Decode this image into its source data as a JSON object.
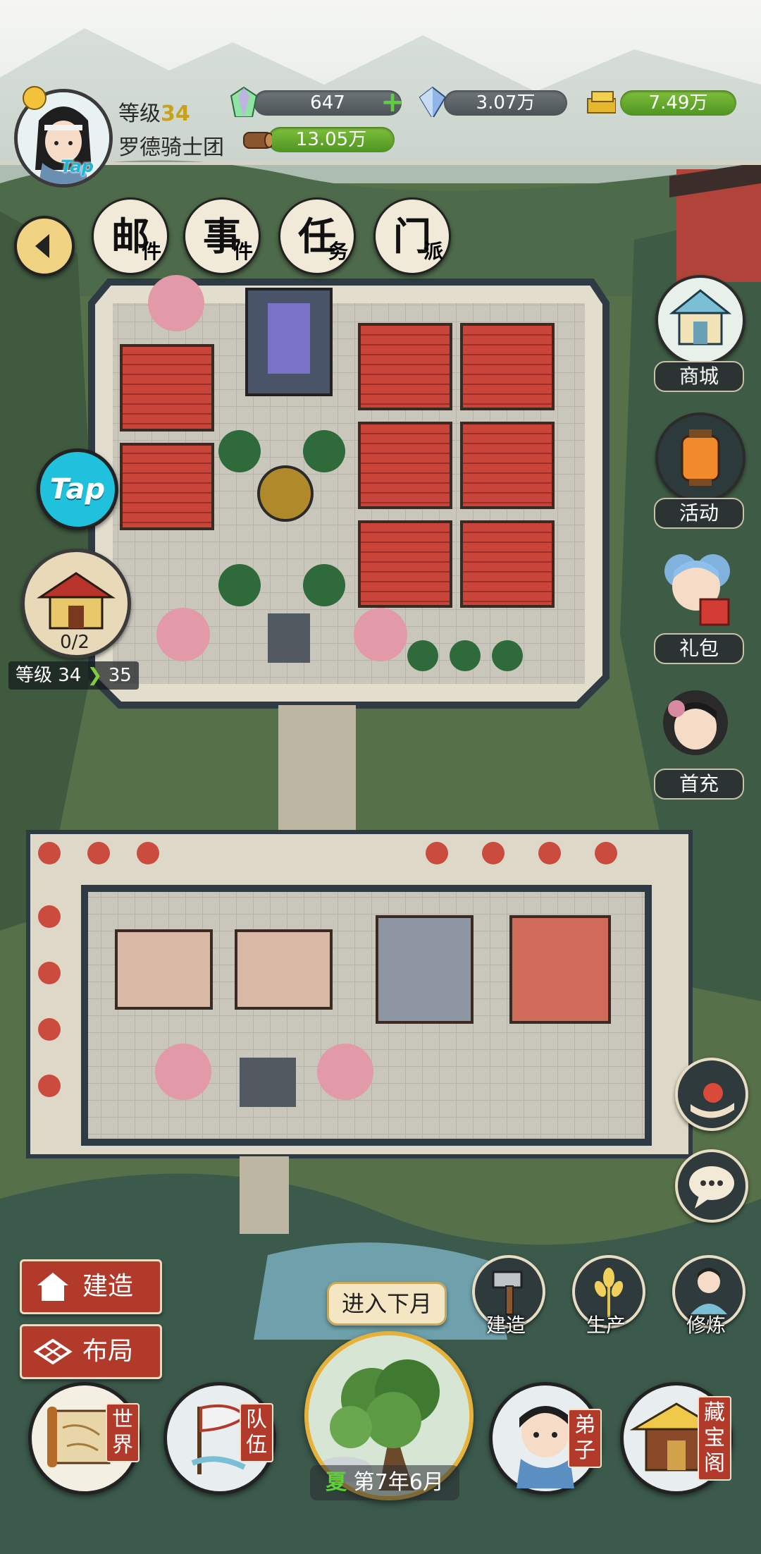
{
  "player": {
    "level_label": "等级",
    "level_value": "34",
    "guild_name": "罗德骑士团",
    "avatar_badge": "Tap"
  },
  "resources": {
    "gem": "647",
    "crystal": "3.07万",
    "gold": "7.49万",
    "wood": "13.05万"
  },
  "top_nav": [
    {
      "main": "邮",
      "sub": "件"
    },
    {
      "main": "事",
      "sub": "件"
    },
    {
      "main": "任",
      "sub": "务"
    },
    {
      "main": "门",
      "sub": "派"
    }
  ],
  "right_menu": {
    "shop": "商城",
    "activity": "活动",
    "gift": "礼包",
    "first_charge": "首充"
  },
  "left_panel": {
    "tap_label": "Tap",
    "building_progress": "0/2",
    "level_from_label": "等级 34",
    "level_to": "35"
  },
  "bottom_left": {
    "build": "建造",
    "layout": "布局"
  },
  "actions": {
    "build": "建造",
    "produce": "生产",
    "cultivate": "修炼"
  },
  "center": {
    "next_month": "进入下月",
    "season": "夏",
    "date": "第7年6月"
  },
  "bottom_nav": {
    "world": [
      "世",
      "界"
    ],
    "team": [
      "队",
      "伍"
    ],
    "disciple": [
      "弟",
      "子"
    ],
    "treasury": [
      "藏",
      "宝",
      "阁"
    ]
  },
  "colors": {
    "accent_red": "#b23a2b",
    "hud_green": "#5cb02e",
    "parchment": "#f1ead9"
  }
}
